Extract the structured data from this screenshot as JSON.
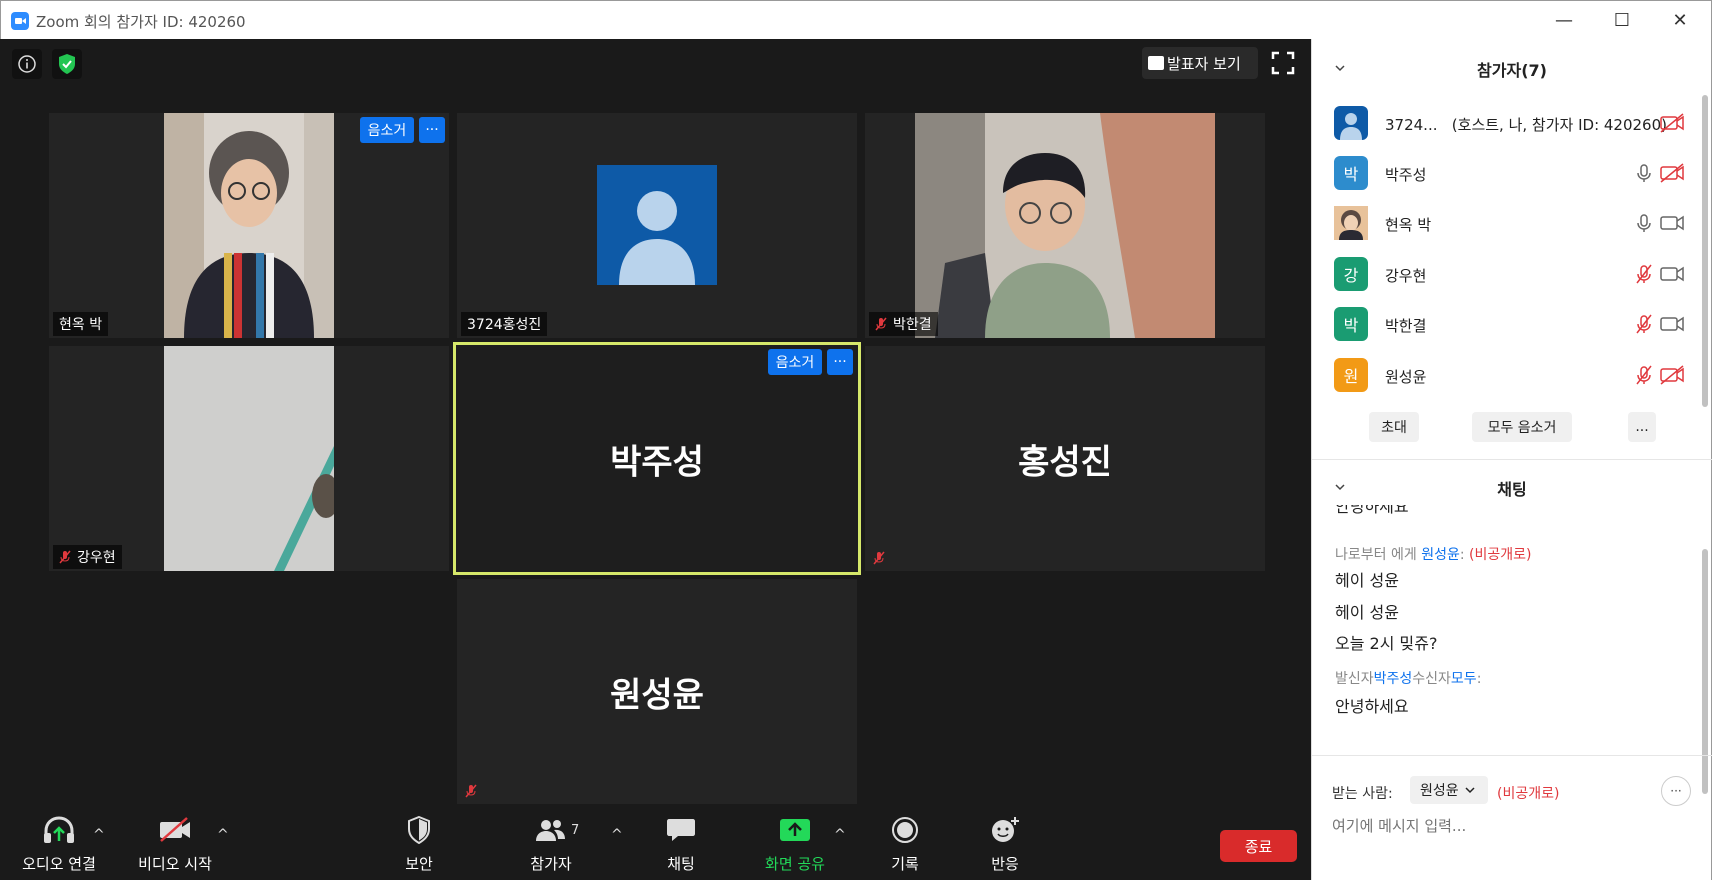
{
  "window": {
    "title": "Zoom 회의 참가자 ID: 420260",
    "minimize": "—",
    "maximize": "☐",
    "close": "✕"
  },
  "video": {
    "speaker_view_label": "발표자 보기",
    "tiles": [
      {
        "name": "현옥 박",
        "muted": false,
        "has_video": true
      },
      {
        "name": "3724홍성진",
        "muted": false,
        "has_video": false
      },
      {
        "name": "박한결",
        "muted": true,
        "has_video": true
      },
      {
        "name": "강우현",
        "muted": true,
        "has_video": true
      },
      {
        "name": "박주성",
        "muted": false,
        "has_video": false
      },
      {
        "name": "홍성진",
        "muted": true,
        "has_video": false
      },
      {
        "name": "원성윤",
        "muted": true,
        "has_video": false
      }
    ],
    "mute_button_label": "음소거",
    "more_button_label": "···"
  },
  "toolbar": {
    "audio_label": "오디오 연결",
    "video_label": "비디오 시작",
    "security_label": "보안",
    "participants_label": "참가자",
    "participants_count": "7",
    "chat_label": "채팅",
    "share_label": "화면 공유",
    "record_label": "기록",
    "reactions_label": "반응",
    "end_label": "종료",
    "caret": "^"
  },
  "participants_panel": {
    "title": "참가자(7)",
    "rows": [
      {
        "avatar": "",
        "name": "3724...",
        "detail": "(호스트, 나, 참가자 ID: 420260)",
        "color": "#0e5aa7"
      },
      {
        "avatar": "박",
        "name": "박주성",
        "color": "#2d8ccd"
      },
      {
        "avatar": "",
        "name": "현옥 박",
        "color": "#d8a06a"
      },
      {
        "avatar": "강",
        "name": "강우현",
        "color": "#1a9c72"
      },
      {
        "avatar": "박",
        "name": "박한결",
        "color": "#1a9c72"
      },
      {
        "avatar": "원",
        "name": "원성윤",
        "color": "#f29a16"
      }
    ],
    "invite_label": "초대",
    "mute_all_label": "모두 음소거",
    "more_label": "..."
  },
  "chat_panel": {
    "title": "채팅",
    "partial_line": "안녕하세요",
    "msg1_from": "나로부터 에게",
    "msg1_to": "원성윤",
    "msg1_colon": ":",
    "msg1_private": "(비공개로)",
    "lines1": [
      "헤이 성윤",
      "헤이 성윤",
      "오늘 2시 밎쥬?"
    ],
    "msg2_sender_prefix": "발신자",
    "msg2_sender": "박주성",
    "msg2_receiver_prefix": "수신자",
    "msg2_receiver": "모두",
    "msg2_colon": ":",
    "msg2_text": "안녕하세요",
    "recipient_label": "받는 사람:",
    "recipient_value": "원성윤",
    "recipient_private": "(비공개로)",
    "input_placeholder": "여기에 메시지 입력...",
    "more_label": "···"
  },
  "colors": {
    "accent": "#0e72ed",
    "active_speaker": "#d6e86a",
    "end": "#d92b2b",
    "share": "#23d959"
  }
}
